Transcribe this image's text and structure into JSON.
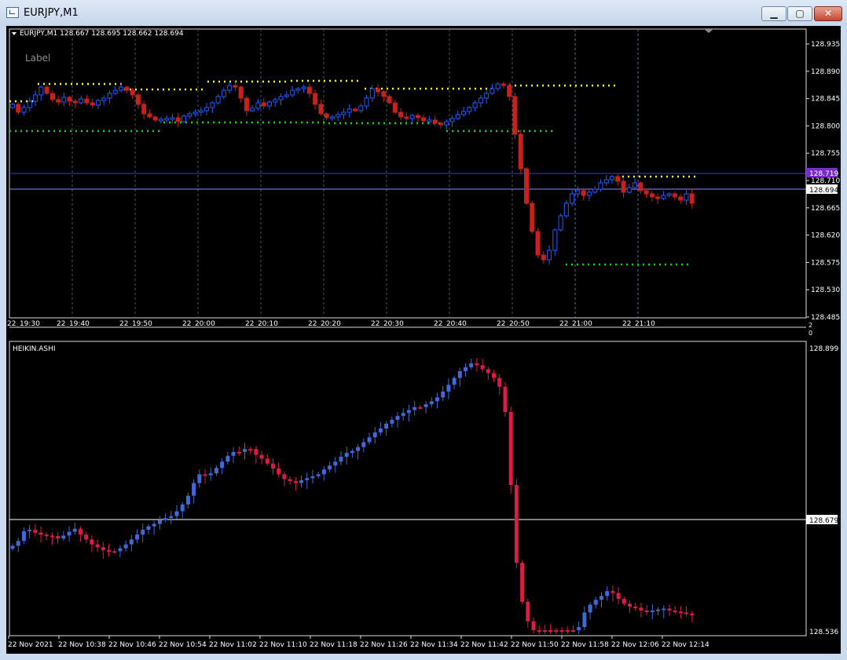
{
  "window": {
    "title": "EURJPY,M1",
    "minimize_glyph": "▁",
    "maximize_glyph": "▢",
    "close_glyph": "✕"
  },
  "main_chart": {
    "header_text": "EURJPY,M1  128.667 128.695 128.662 128.694",
    "label_text": "Label",
    "price_ticks": [
      "128.935",
      "128.890",
      "128.845",
      "128.800",
      "128.755",
      "128.710",
      "128.665",
      "128.620",
      "128.575",
      "128.530",
      "128.485"
    ],
    "current_price": "128.694",
    "level_price": "128.719",
    "time_labels": [
      "22_19:30",
      "22_19:40",
      "22_19:50",
      "22_20:00",
      "22_20:10",
      "22_20:20",
      "22_20:30",
      "22_20:40",
      "22_20:50",
      "22_21:00",
      "22_21:10"
    ],
    "sub_scale": [
      "2",
      "0"
    ],
    "colors": {
      "bull": "#1e5cff",
      "bear": "#c8201c",
      "resistance": "#ffff00",
      "support": "#00e000",
      "bid_line": "#8a8aff",
      "level_line": "#3a3ad8",
      "level_box": "#7a2ac8"
    }
  },
  "sub_chart": {
    "title": "HEIKIN.ASHI",
    "price_top": "128.899",
    "price_mid": "128.679",
    "price_bottom": "128.536",
    "time_labels": [
      "22 Nov 2021",
      "22 Nov 10:38",
      "22 Nov 10:46",
      "22 Nov 10:54",
      "22 Nov 11:02",
      "22 Nov 11:10",
      "22 Nov 11:18",
      "22 Nov 11:26",
      "22 Nov 11:34",
      "22 Nov 11:42",
      "22 Nov 11:50",
      "22 Nov 11:58",
      "22 Nov 12:06",
      "22 Nov 12:14"
    ],
    "colors": {
      "bull": "#3f68d8",
      "bear": "#dc1c46"
    }
  }
}
